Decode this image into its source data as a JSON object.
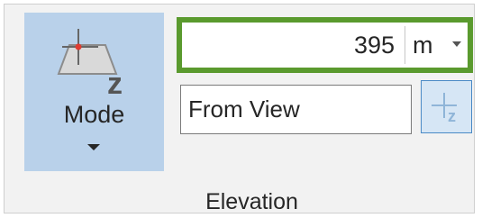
{
  "mode": {
    "label": "Mode",
    "icon": "elevation-mode-icon"
  },
  "elevation": {
    "value": "395",
    "unit": "m",
    "accent_color": "#5a9a2e"
  },
  "source": {
    "selected": "From View"
  },
  "pick_button": {
    "icon": "pick-elevation-icon"
  },
  "group": {
    "label": "Elevation"
  },
  "colors": {
    "mode_button_bg": "#b9d1ea",
    "pick_button_border": "#4a8ac6"
  }
}
